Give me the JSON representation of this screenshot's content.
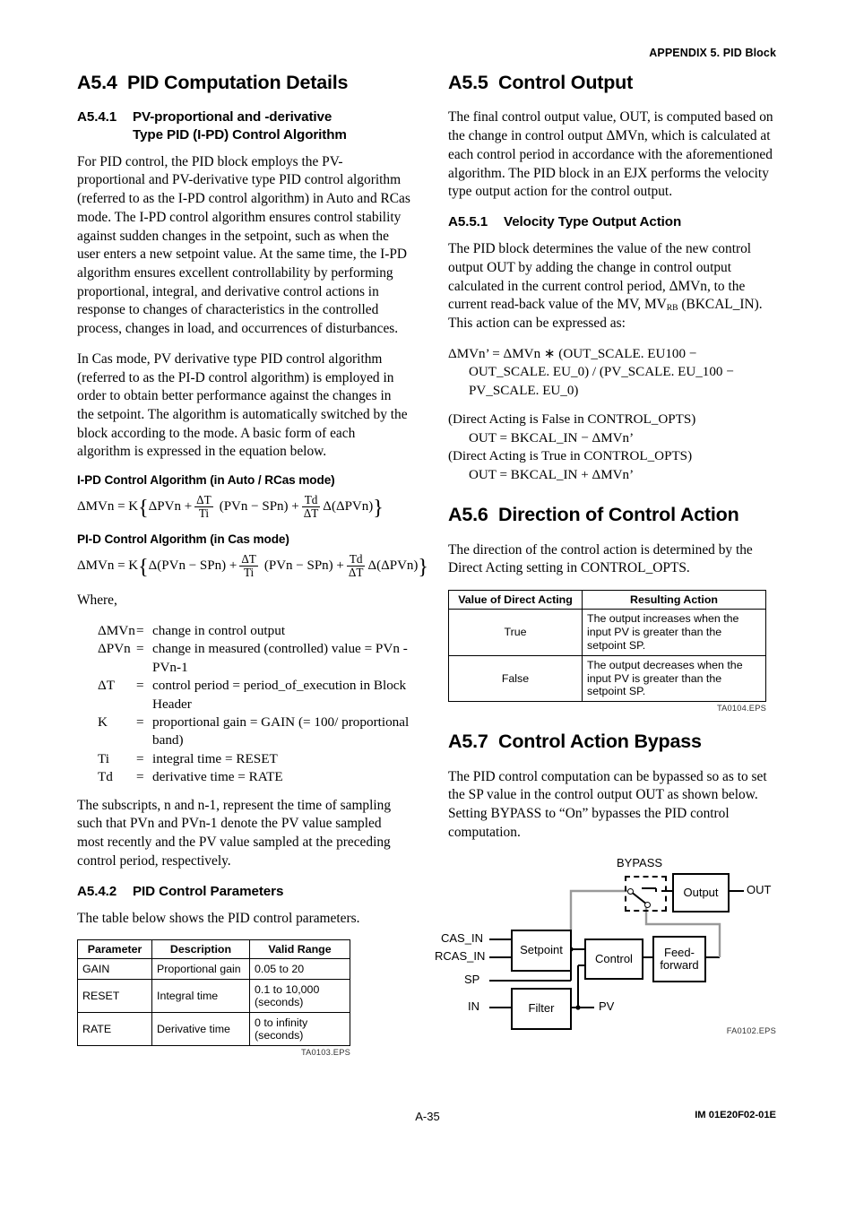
{
  "header": {
    "running_head": "APPENDIX 5.  PID Block"
  },
  "footer": {
    "page_number": "A-35",
    "doc_number": "IM 01E20F02-01E"
  },
  "left_column": {
    "section_a54": {
      "num": "A5.4",
      "title": "PID Computation Details"
    },
    "section_a541": {
      "num": "A5.4.1",
      "title_line1": "PV-proportional and -derivative",
      "title_line2": "Type PID (I-PD) Control Algorithm",
      "para1": "For PID control, the PID block employs the PV-proportional and PV-derivative type PID control algorithm (referred to as the I-PD control algorithm) in Auto and RCas mode. The I-PD control algorithm ensures control stability against sudden changes in the setpoint, such as when the user enters a new setpoint value. At the same time, the I-PD algorithm ensures excellent controllability by performing proportional, integral, and derivative control actions in response to changes of characteristics in the controlled process, changes in load, and occurrences of disturbances.",
      "para2": "In Cas mode, PV derivative type PID control algorithm (referred to as the PI-D control algorithm) is employed in order to obtain better performance against the changes in the setpoint. The algorithm is automatically switched by the block according to the mode. A basic form of each algorithm is expressed in the equation below."
    },
    "algorithm_ipd": {
      "heading": "I-PD Control Algorithm (in Auto / RCas mode)",
      "lhs": "ΔMVn  =  K",
      "brace_open": "{",
      "term1": "ΔPVn  +",
      "frac1_num": "ΔT",
      "frac1_den": "Ti",
      "term2": "(PVn  −  SPn)  +",
      "frac2_num": "Td",
      "frac2_den": "ΔT",
      "term3": "Δ(ΔPVn)",
      "brace_close": "}"
    },
    "algorithm_pid": {
      "heading": "PI-D Control Algorithm (in Cas mode)",
      "lhs": "ΔMVn  =  K",
      "brace_open": "{",
      "term1": "Δ(PVn  −  SPn)  +",
      "frac1_num": "ΔT",
      "frac1_den": "Ti",
      "term2": "(PVn  −  SPn)  +",
      "frac2_num": "Td",
      "frac2_den": "ΔT",
      "term3": "Δ(ΔPVn)",
      "brace_close": "}"
    },
    "where_label": "Where,",
    "definitions": [
      {
        "symbol": "ΔMVn",
        "eq": "=",
        "desc": "change in control output"
      },
      {
        "symbol": "ΔPVn",
        "eq": "=",
        "desc": "change in measured (controlled) value = PVn - PVn-1"
      },
      {
        "symbol": "ΔT",
        "eq": "=",
        "desc": "control period = period_of_execution in Block Header"
      },
      {
        "symbol": "K",
        "eq": "=",
        "desc": "proportional gain = GAIN (= 100/ proportional band)"
      },
      {
        "symbol": "Ti",
        "eq": "=",
        "desc": "integral time = RESET"
      },
      {
        "symbol": "Td",
        "eq": "=",
        "desc": "derivative time = RATE"
      }
    ],
    "para_subscripts": "The subscripts, n and n-1, represent the time of sampling such that PVn and PVn-1 denote the PV value sampled most recently and the PV value sampled at the preceding control period, respectively.",
    "section_a542": {
      "num": "A5.4.2",
      "title": "PID Control Parameters",
      "intro": "The table below shows the PID control parameters."
    },
    "param_table": {
      "headers": [
        "Parameter",
        "Description",
        "Valid Range"
      ],
      "rows": [
        [
          "GAIN",
          "Proportional gain",
          "0.05 to 20"
        ],
        [
          "RESET",
          "Integral time",
          "0.1 to 10,000 (seconds)"
        ],
        [
          "RATE",
          "Derivative time",
          "0 to infinity (seconds)"
        ]
      ],
      "caption": "TA0103.EPS"
    }
  },
  "right_column": {
    "section_a55": {
      "num": "A5.5",
      "title": "Control Output",
      "para1": "The final control output value, OUT, is computed based on the change in control output ΔMVn, which is calculated at each control period in accordance with the aforementioned algorithm.  The PID block in an EJX performs the velocity type output action for the control output."
    },
    "section_a551": {
      "num": "A5.5.1",
      "title": "Velocity Type Output Action",
      "para1_a": "The PID block determines the value of the new control output OUT by adding the change in control output calculated in the current control period, ΔMVn, to the current read-back value of the MV, MV",
      "para1_sub": "RB",
      "para1_b": "(BKCAL_IN).  This action can be expressed as:"
    },
    "equations": {
      "line1": "ΔMVn’ = ΔMVn ∗ (OUT_SCALE. EU100 −",
      "line2": "OUT_SCALE. EU_0) /  (PV_SCALE. EU_100 −",
      "line3": "PV_SCALE. EU_0)",
      "line4": "(Direct Acting is False in CONTROL_OPTS)",
      "line5": "OUT = BKCAL_IN − ΔMVn’",
      "line6": "(Direct Acting is True in CONTROL_OPTS)",
      "line7": "OUT = BKCAL_IN + ΔMVn’"
    },
    "section_a56": {
      "num": "A5.6",
      "title": "Direction of Control Action",
      "para1": "The direction of the control action is determined by the Direct Acting setting in CONTROL_OPTS."
    },
    "direction_table": {
      "headers": [
        "Value of Direct Acting",
        "Resulting Action"
      ],
      "rows": [
        [
          "True",
          "The output increases when the input PV is greater than the setpoint SP."
        ],
        [
          "False",
          "The output decreases when the input PV is greater than the setpoint SP."
        ]
      ],
      "caption": "TA0104.EPS"
    },
    "section_a57": {
      "num": "A5.7",
      "title": "Control Action Bypass",
      "para1": "The PID control computation can be bypassed so as to set the SP value in the control output OUT as shown below.  Setting BYPASS to “On” bypasses the PID control computation."
    },
    "diagram": {
      "caption": "FA0102.EPS",
      "bypass_label": "BYPASS",
      "boxes": {
        "setpoint": "Setpoint",
        "control": "Control",
        "feedforward_line1": "Feed-",
        "feedforward_line2": "forward",
        "output": "Output",
        "filter": "Filter"
      },
      "ports": {
        "cas_in": "CAS_IN",
        "rcas_in": "RCAS_IN",
        "sp": "SP",
        "in": "IN",
        "pv": "PV",
        "out": "OUT"
      }
    }
  }
}
